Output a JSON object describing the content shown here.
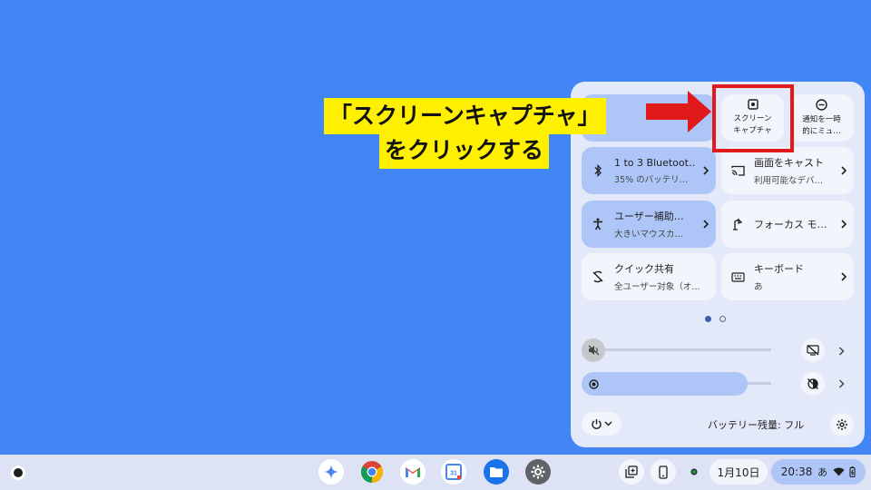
{
  "quick_settings": {
    "small_tiles": [
      {
        "label": "スクリーン\nキャプチャ",
        "icon": "screen-capture-icon"
      },
      {
        "label": "通知を一時\n的にミュ…",
        "icon": "do-not-disturb-icon"
      }
    ],
    "tiles": [
      {
        "title": "1 to 3 Bluetoot…",
        "subtitle": "35% のバッテリ…",
        "icon": "bluetooth-icon",
        "active": true
      },
      {
        "title": "画面をキャスト",
        "subtitle": "利用可能なデバ…",
        "icon": "cast-icon",
        "active": false
      },
      {
        "title": "ユーザー補助…",
        "subtitle": "大きいマウスカ…",
        "icon": "accessibility-icon",
        "active": true
      },
      {
        "title": "フォーカス モ…",
        "subtitle": "",
        "icon": "focus-lamp-icon",
        "active": false
      },
      {
        "title": "クイック共有",
        "subtitle": "全ユーザー対象（オ…",
        "icon": "quick-share-icon",
        "active": false
      },
      {
        "title": "キーボード",
        "subtitle": "あ",
        "icon": "keyboard-icon",
        "active": false
      }
    ],
    "page_count": 2,
    "current_page": 1,
    "volume": {
      "icon": "volume-muted-icon",
      "level": 0
    },
    "brightness": {
      "icon": "brightness-icon",
      "level": 0.87
    },
    "battery_label": "バッテリー残量: フル"
  },
  "annotation": {
    "line1": "「スクリーンキャプチャ」",
    "line2": "をクリックする",
    "arrow_color": "#e01a1a",
    "highlight_color": "#ffef00"
  },
  "shelf": {
    "apps": [
      "gemini-icon",
      "chrome-icon",
      "gmail-icon",
      "calendar-icon",
      "files-icon",
      "settings-icon"
    ],
    "calendar_day": "31",
    "date": "1月10日",
    "time": "20:38",
    "ime": "あ"
  }
}
